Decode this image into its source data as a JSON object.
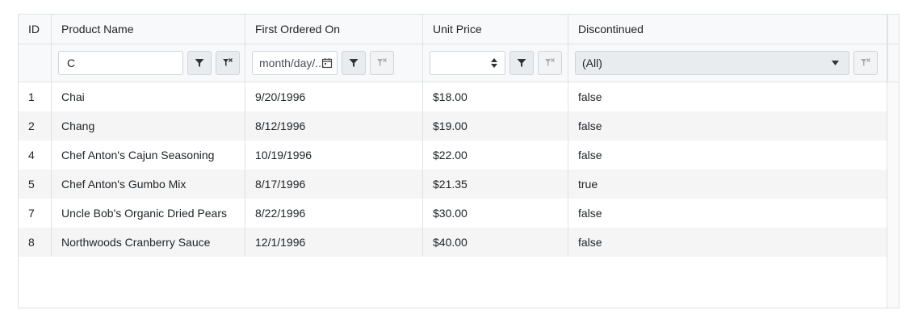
{
  "columns": {
    "id": "ID",
    "name": "Product Name",
    "date": "First Ordered On",
    "price": "Unit Price",
    "discontinued": "Discontinued"
  },
  "filters": {
    "name_value": "C",
    "date_placeholder": "month/day/...",
    "price_value": "",
    "discontinued_value": "(All)"
  },
  "rows": [
    {
      "id": "1",
      "name": "Chai",
      "date": "9/20/1996",
      "price": "$18.00",
      "discontinued": "false"
    },
    {
      "id": "2",
      "name": "Chang",
      "date": "8/12/1996",
      "price": "$19.00",
      "discontinued": "false"
    },
    {
      "id": "4",
      "name": "Chef Anton's Cajun Seasoning",
      "date": "10/19/1996",
      "price": "$22.00",
      "discontinued": "false"
    },
    {
      "id": "5",
      "name": "Chef Anton's Gumbo Mix",
      "date": "8/17/1996",
      "price": "$21.35",
      "discontinued": "true"
    },
    {
      "id": "7",
      "name": "Uncle Bob's Organic Dried Pears",
      "date": "8/22/1996",
      "price": "$30.00",
      "discontinued": "false"
    },
    {
      "id": "8",
      "name": "Northwoods Cranberry Sauce",
      "date": "12/1/1996",
      "price": "$40.00",
      "discontinued": "false"
    }
  ],
  "icons": {
    "filter": "filter-icon",
    "clear_filter": "filter-clear-icon",
    "calendar": "calendar-icon",
    "spinner": "spinner-icon",
    "dropdown": "chevron-down-icon"
  }
}
